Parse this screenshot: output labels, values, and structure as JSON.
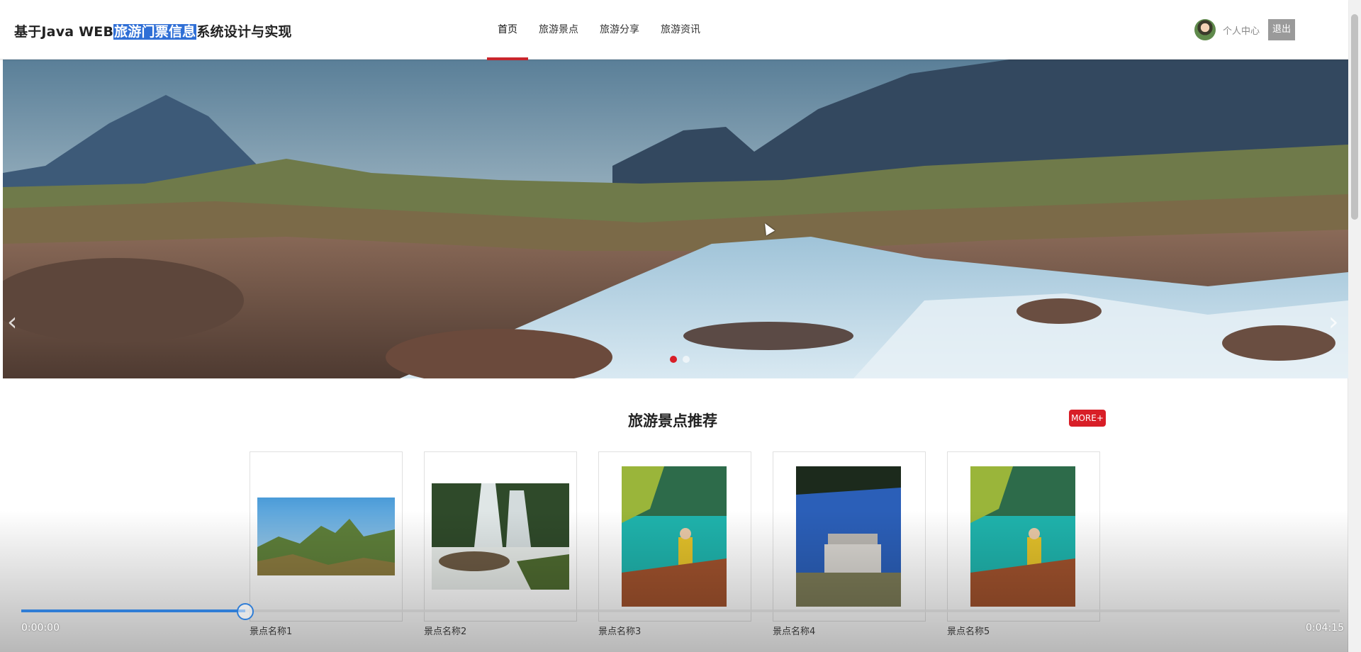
{
  "header": {
    "title_prefix": "基于Java WEB",
    "title_highlight": "旅游门票信息",
    "title_suffix": "系统设计与实现",
    "nav": [
      {
        "label": "首页",
        "active": true
      },
      {
        "label": "旅游景点",
        "active": false
      },
      {
        "label": "旅游分享",
        "active": false
      },
      {
        "label": "旅游资讯",
        "active": false
      }
    ],
    "user_center": "个人中心",
    "logout": "退出"
  },
  "banner": {
    "slide_count": 2,
    "active_slide": 1
  },
  "section": {
    "title": "旅游景点推荐",
    "more": "MORE+"
  },
  "attractions": [
    {
      "name": "景点名称1"
    },
    {
      "name": "景点名称2"
    },
    {
      "name": "景点名称3"
    },
    {
      "name": "景点名称4"
    },
    {
      "name": "景点名称5"
    }
  ],
  "video": {
    "current_time": "0:00:00",
    "duration": "0:04:15",
    "progress": 0.17
  },
  "colors": {
    "accent_red": "#d81e27",
    "progress_blue": "#2f7dd6",
    "highlight_blue": "#2f6fd6"
  }
}
